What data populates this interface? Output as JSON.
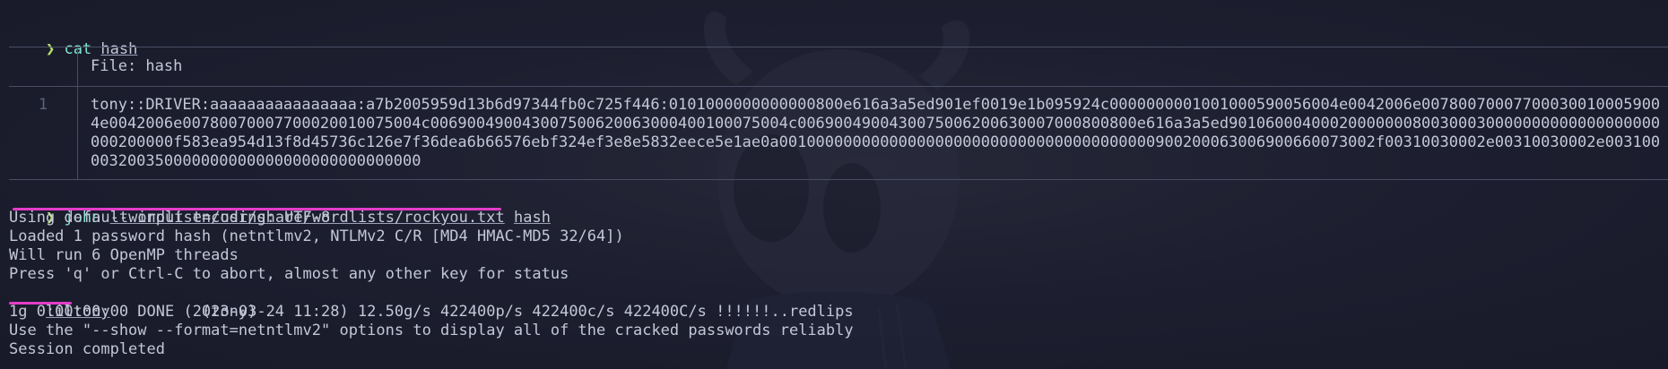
{
  "prompt_symbol": "❯",
  "commands": [
    {
      "program": "cat",
      "args": [
        "hash"
      ]
    },
    {
      "program": "john",
      "args": [
        "--wordlist=/usr/share/wordlists/rockyou.txt",
        "hash"
      ]
    }
  ],
  "bat": {
    "file_label": "File: hash",
    "line_number": "1",
    "content_rows": [
      "tony::DRIVER:aaaaaaaaaaaaaaaa:a7b2005959d13b6d97344fb0c725f446:0101000000000000800e616a3a5ed901ef0019e1b095924c0000000001001000590056004e0042006e0078007000770003001000590056004e0042006e007800700077000200100075004c006900490043007500620063000400100075004c006900490043007500620063000700080800e616a3a5ed901060004000200000008003000300000000000000000000000000200000f583ea954d13f8d45736c126e7f36dea6b66576ebf324ef3e8e5832eece5e1ae0a001000000000000000000000000000000000000090020006300690066007300",
      "4e0042006e00780070007700020010075004c006900490043007500620063000400100075004c0069004900430075006200630007000800800e616a3a5ed901060004000200000008003000300000000000000000000000",
      "000200000f583ea954d13f8d45736c126e7f36dea6b66576ebf324ef3e8e5832eece5e1ae0a00100000000000000000000000000000000000000900200063006900660073002f00310030002e00310030002e00310034002e",
      "003200350000000000000000000000000000"
    ]
  },
  "output_lines": [
    "Using default input encoding: UTF-8",
    "Loaded 1 password hash (netntlmv2, NTLMv2 C/R [MD4 HMAC-MD5 32/64])",
    "Will run 6 OpenMP threads",
    "Press 'q' or Ctrl-C to abort, almost any other key for status"
  ],
  "cracked": {
    "password": "liltony",
    "user": "(tony)"
  },
  "result_lines": [
    "1g 0:00:00:00 DONE (2023-03-24 11:28) 12.50g/s 422400p/s 422400c/s 422400C/s !!!!!!..redlips",
    "Use the \"--show --format=netntlmv2\" options to display all of the cracked passwords reliably",
    "Session completed"
  ],
  "colors": {
    "background": "#1b1d2e",
    "prompt": "#b7e36a",
    "command": "#7fe7d0",
    "text": "#c3c7d6",
    "highlight_underline": "#e43cc9",
    "box_border": "#4a4d62"
  },
  "icons": {
    "wallpaper": "hollow-knight-mask-illustration"
  }
}
